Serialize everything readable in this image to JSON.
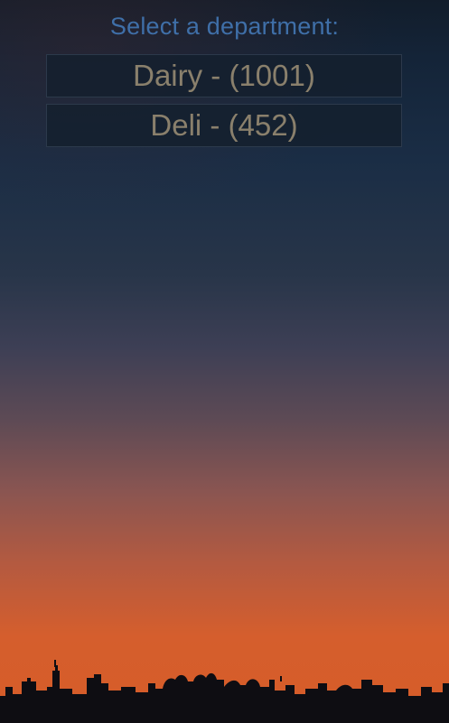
{
  "prompt": "Select a department:",
  "departments": [
    {
      "label": "Dairy - (1001)"
    },
    {
      "label": "Deli - (452)"
    }
  ],
  "colors": {
    "prompt_text": "#3f6fa8",
    "item_text": "#8a806c",
    "item_background": "#14202e"
  }
}
